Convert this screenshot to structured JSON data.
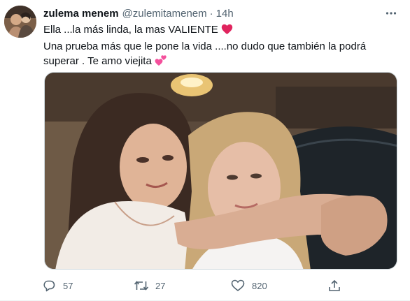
{
  "tweet": {
    "display_name": "zulema menem",
    "handle": "@zulemitamenem",
    "separator": "·",
    "time": "14h",
    "text_line1": "Ella ...la más linda, la mas VALIENTE",
    "text_line2": "Una prueba más que le  pone la vida ....no dudo que también  la podrá superar . Te amo viejita",
    "emoji_line1": "red-heart",
    "emoji_line2": "two-hearts"
  },
  "actions": {
    "reply_count": "57",
    "retweet_count": "27",
    "like_count": "820"
  },
  "icons": {
    "more": "more-icon",
    "reply": "reply-icon",
    "retweet": "retweet-icon",
    "like": "like-icon",
    "share": "share-icon"
  },
  "colors": {
    "text": "#0f1419",
    "secondary": "#536471",
    "heart_red": "#e0245e",
    "heart_pink": "#f4509c"
  }
}
